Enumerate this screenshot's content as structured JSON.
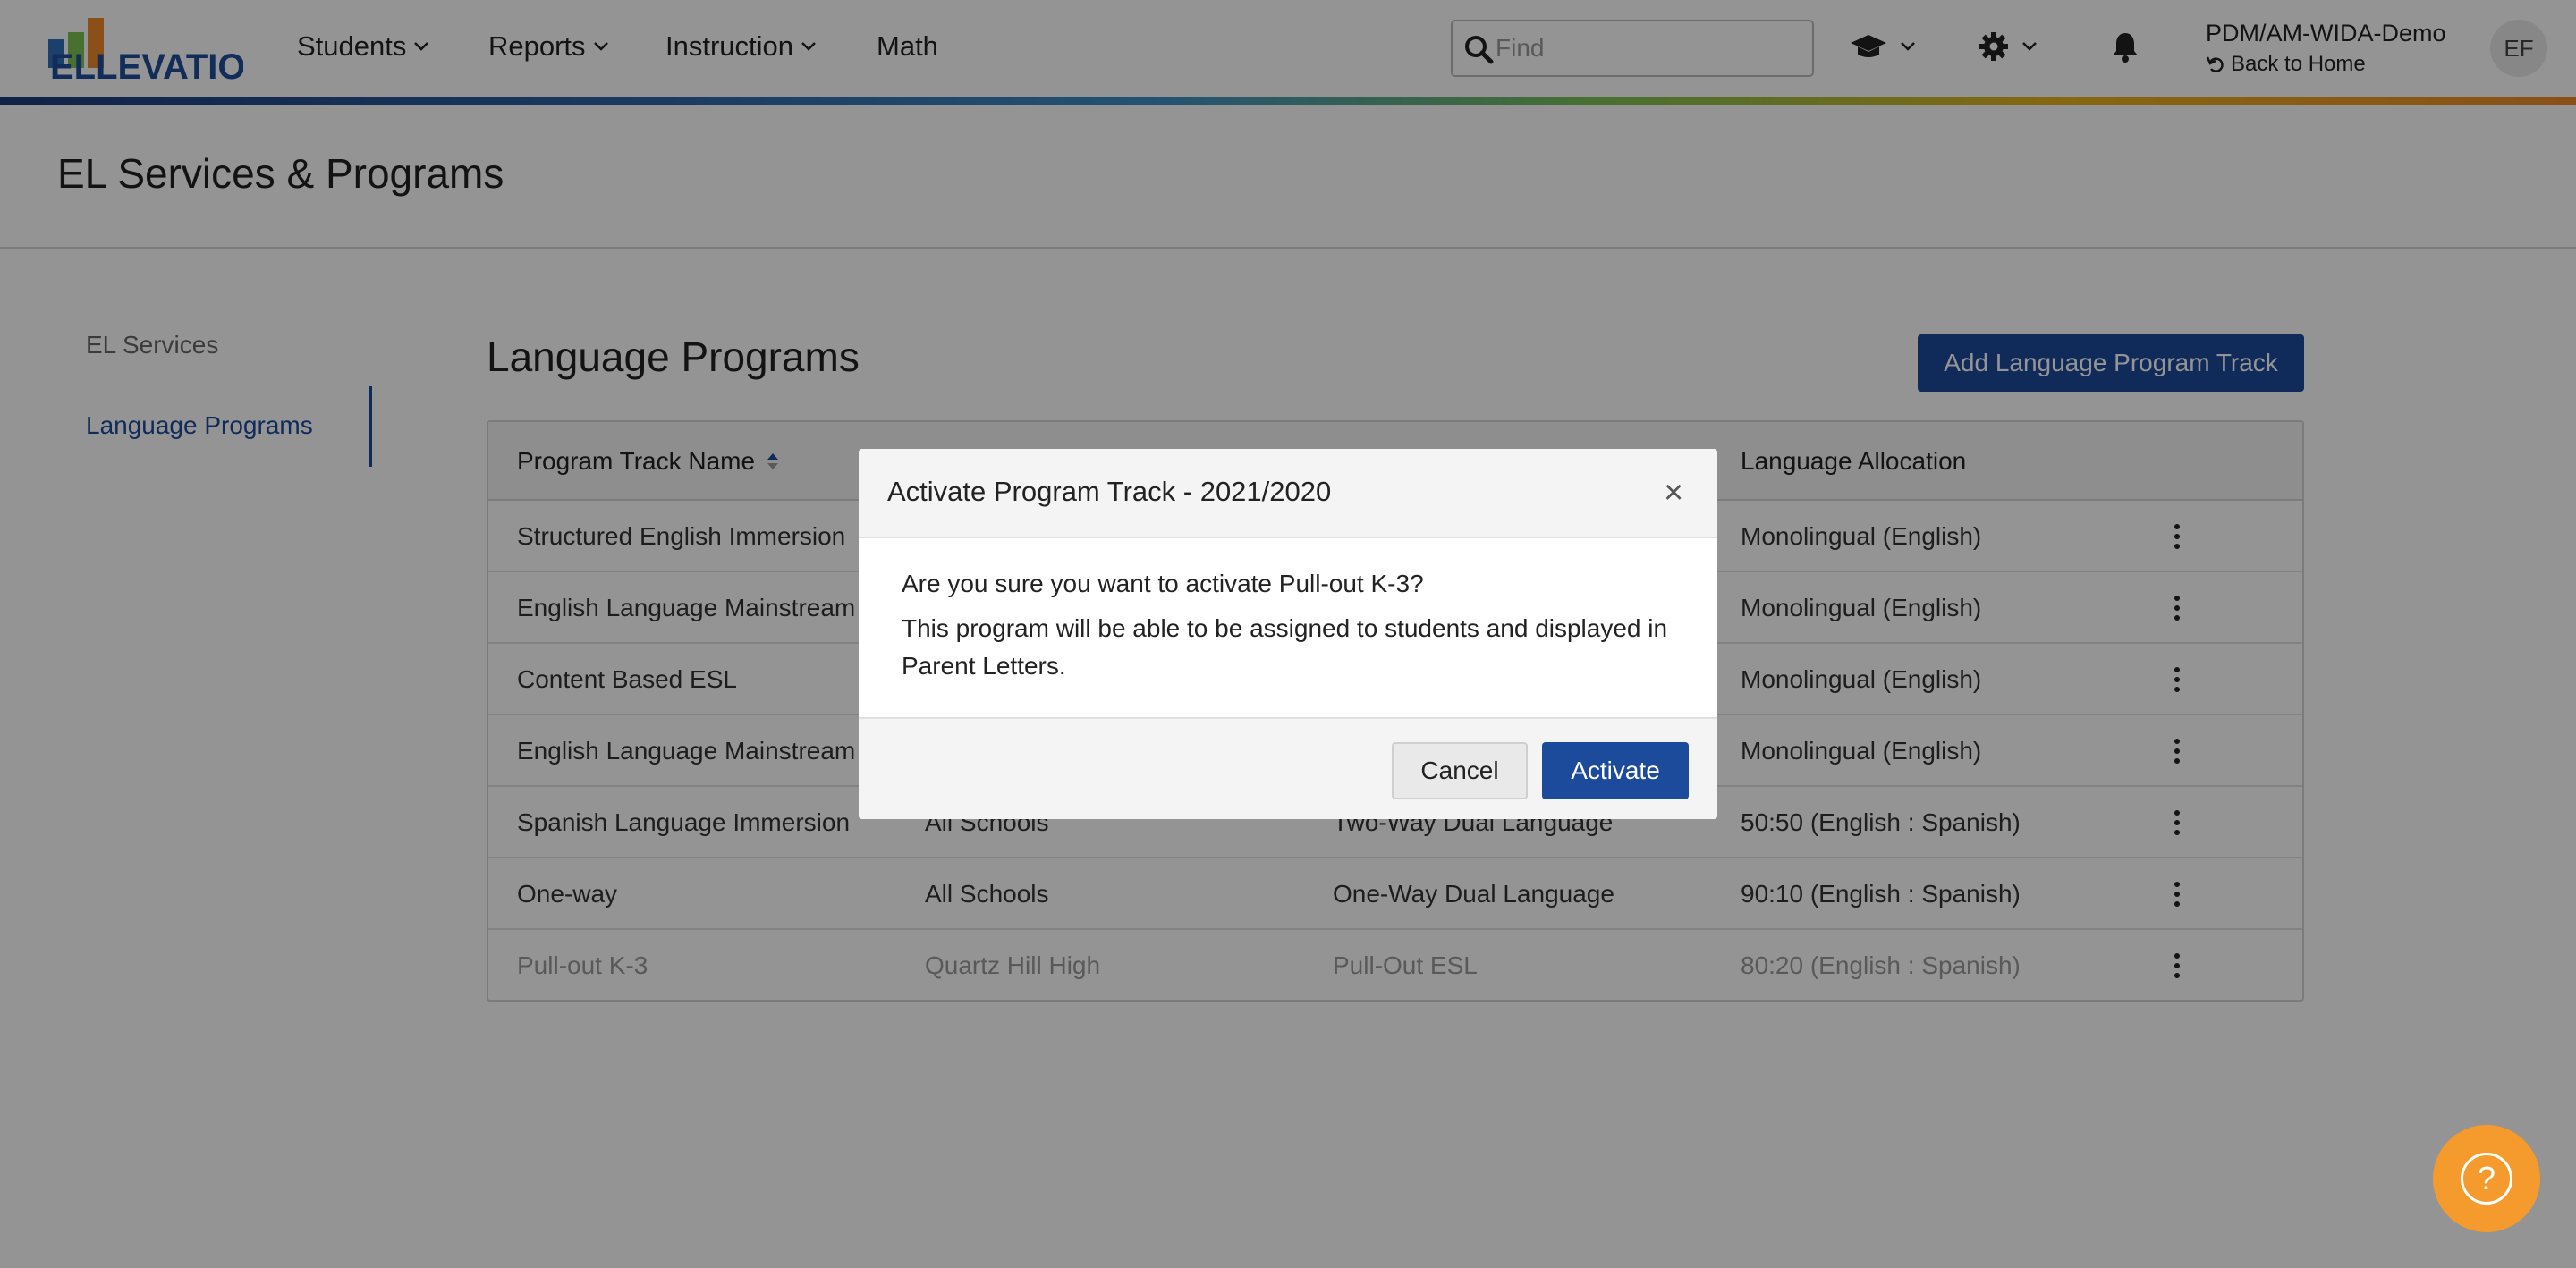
{
  "app": {
    "logo_text": "ELLEVATION",
    "brand_colors": {
      "primary": "#1d4b9c",
      "help": "#f59a2c",
      "logo_orange": "#f08a2a",
      "logo_blue": "#2d6fb8"
    }
  },
  "header": {
    "nav": [
      {
        "label": "Students",
        "has_dropdown": true
      },
      {
        "label": "Reports",
        "has_dropdown": true
      },
      {
        "label": "Instruction",
        "has_dropdown": true
      },
      {
        "label": "Math",
        "has_dropdown": false
      }
    ],
    "search": {
      "placeholder": "Find",
      "value": ""
    },
    "icons": [
      "graduation-cap-icon",
      "gear-icon",
      "bell-icon"
    ],
    "org_name": "PDM/AM-WIDA-Demo",
    "back_label": "Back to Home",
    "avatar_initials": "EF"
  },
  "page": {
    "title": "EL Services & Programs"
  },
  "sidebar": {
    "items": [
      {
        "label": "EL Services",
        "active": false
      },
      {
        "label": "Language Programs",
        "active": true
      }
    ]
  },
  "main": {
    "title": "Language Programs",
    "add_button": "Add Language Program Track",
    "table": {
      "columns": [
        "Program Track Name",
        "",
        "",
        "Language Allocation"
      ],
      "sort_column": "Program Track Name",
      "rows": [
        {
          "name": "Structured English Immersion",
          "schools": "",
          "model": "",
          "allocation": "Monolingual (English)",
          "inactive": false
        },
        {
          "name": "English Language Mainstream",
          "schools": "",
          "model": "",
          "allocation": "Monolingual (English)",
          "inactive": false
        },
        {
          "name": "Content Based ESL",
          "schools": "",
          "model": "",
          "allocation": "Monolingual (English)",
          "inactive": false
        },
        {
          "name": "English Language Mainstream",
          "schools": "",
          "model": "",
          "allocation": "Monolingual (English)",
          "inactive": false
        },
        {
          "name": "Spanish Language Immersion",
          "schools": "All Schools",
          "model": "Two-Way Dual Language",
          "allocation": "50:50 (English : Spanish)",
          "inactive": false
        },
        {
          "name": "One-way",
          "schools": "All Schools",
          "model": "One-Way Dual Language",
          "allocation": "90:10 (English : Spanish)",
          "inactive": false
        },
        {
          "name": "Pull-out K-3",
          "schools": "Quartz Hill High",
          "model": "Pull-Out ESL",
          "allocation": "80:20 (English : Spanish)",
          "inactive": true
        }
      ]
    }
  },
  "modal": {
    "title": "Activate Program Track - 2021/2020",
    "line1": "Are you sure you want to activate Pull-out K-3?",
    "line2": "This program will be able to be assigned to students and displayed in Parent Letters.",
    "cancel_label": "Cancel",
    "activate_label": "Activate"
  },
  "help": {
    "label": "?"
  }
}
